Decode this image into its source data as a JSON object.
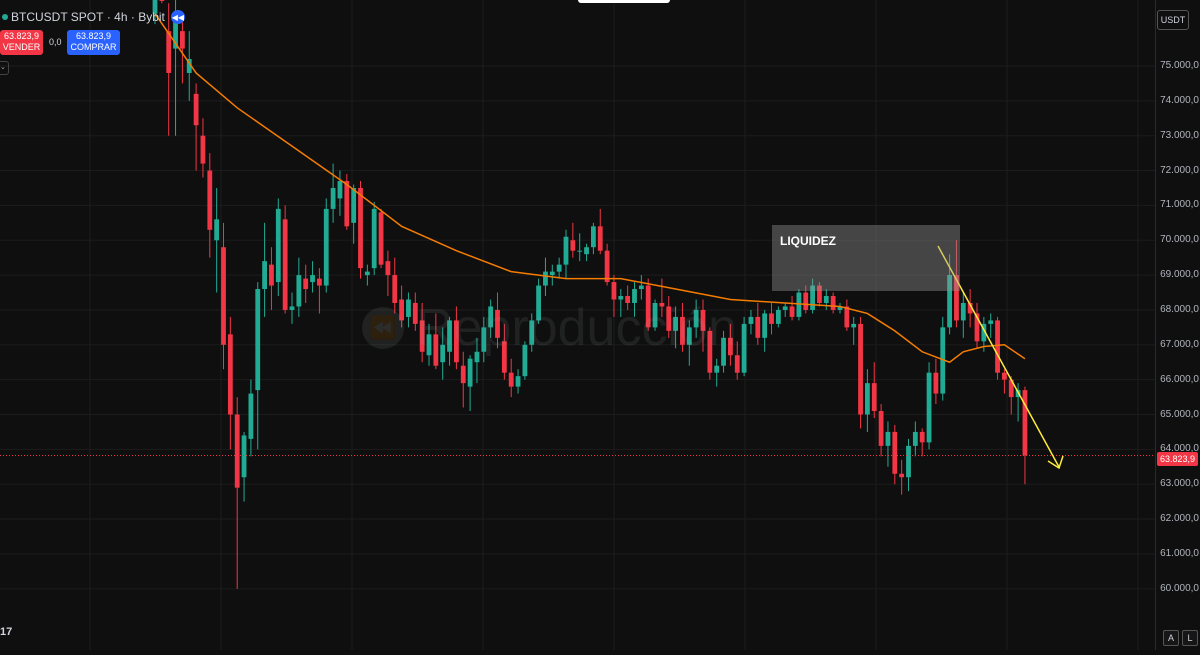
{
  "header": {
    "symbol": "BTCUSDT SPOT",
    "sep1": "·",
    "interval": "4h",
    "sep2": "·",
    "exchange": "Bybit",
    "replay_icon": "fast-backward-icon"
  },
  "trade": {
    "sell_price": "63.823,9",
    "sell_label": "VENDER",
    "spread": "0,0",
    "buy_price": "63.823,9",
    "buy_label": "COMPRAR"
  },
  "currency": "USDT",
  "last_price_label": "63.823,9",
  "watermark": "Reproducción",
  "logo_text": "17",
  "scale_buttons": {
    "auto": "A",
    "log": "L"
  },
  "price_axis": {
    "ticks": [
      "75.000,0",
      "74.000,0",
      "73.000,0",
      "72.000,0",
      "71.000,0",
      "70.000,0",
      "69.000,0",
      "68.000,0",
      "67.000,0",
      "66.000,0",
      "65.000,0",
      "64.000,0",
      "63.000,0",
      "62.000,0",
      "61.000,0",
      "60.000,0"
    ]
  },
  "colors": {
    "up": "#22ab94",
    "down": "#f23645",
    "ma": "#f57c00",
    "trend": "#ffeb3b",
    "background": "#0f0f0f"
  },
  "chart_data": {
    "type": "candlestick",
    "annotations": [
      {
        "type": "rectangle",
        "label": "LIQUIDEZ",
        "price_top": 70450,
        "price_bottom": 68550
      },
      {
        "type": "arrow",
        "color": "#ffeb3b",
        "direction": "down"
      }
    ],
    "last_price": 63823.9,
    "y_range": [
      59500,
      76500
    ],
    "candles": [
      [
        76500,
        78000,
        76200,
        77500
      ],
      [
        77500,
        78500,
        76800,
        77000
      ],
      [
        76000,
        76800,
        73000,
        74800
      ],
      [
        75500,
        77000,
        73000,
        76500
      ],
      [
        76000,
        76500,
        74500,
        75500
      ],
      [
        74800,
        76000,
        74000,
        75200
      ],
      [
        74200,
        74500,
        72000,
        73300
      ],
      [
        73000,
        73500,
        71800,
        72200
      ],
      [
        72000,
        72500,
        69500,
        70300
      ],
      [
        70000,
        71500,
        68500,
        70600
      ],
      [
        69800,
        70500,
        66300,
        67000
      ],
      [
        67300,
        67800,
        64000,
        65000
      ],
      [
        65000,
        65500,
        60000,
        62900
      ],
      [
        63200,
        64500,
        62500,
        64400
      ],
      [
        64300,
        66000,
        63800,
        65600
      ],
      [
        65700,
        68800,
        64000,
        68600
      ],
      [
        68600,
        70500,
        67800,
        69400
      ],
      [
        69300,
        69800,
        68000,
        68700
      ],
      [
        68800,
        71200,
        68400,
        70900
      ],
      [
        70600,
        71000,
        67900,
        68000
      ],
      [
        68000,
        68500,
        67600,
        68100
      ],
      [
        68100,
        69500,
        67800,
        69000
      ],
      [
        68900,
        69300,
        68200,
        68600
      ],
      [
        68800,
        69400,
        68500,
        69000
      ],
      [
        68900,
        69200,
        67900,
        68700
      ],
      [
        68700,
        71200,
        68500,
        70900
      ],
      [
        70900,
        72200,
        70500,
        71500
      ],
      [
        71200,
        72000,
        70700,
        71700
      ],
      [
        71700,
        71900,
        70300,
        70400
      ],
      [
        70500,
        71600,
        69900,
        71500
      ],
      [
        71500,
        71700,
        68900,
        69200
      ],
      [
        69000,
        69300,
        68700,
        69100
      ],
      [
        69200,
        71100,
        69000,
        70900
      ],
      [
        70800,
        70900,
        69200,
        69300
      ],
      [
        69400,
        69700,
        68400,
        69000
      ],
      [
        69000,
        69500,
        67900,
        68200
      ],
      [
        68300,
        68700,
        67500,
        67700
      ],
      [
        67800,
        68500,
        67500,
        68300
      ],
      [
        68200,
        68500,
        67400,
        67600
      ],
      [
        67700,
        68200,
        66500,
        66800
      ],
      [
        66700,
        67600,
        66400,
        67300
      ],
      [
        67300,
        67900,
        66300,
        66400
      ],
      [
        66500,
        67500,
        66000,
        67000
      ],
      [
        66800,
        67800,
        66400,
        67700
      ],
      [
        67700,
        68100,
        66300,
        66500
      ],
      [
        66400,
        66800,
        65200,
        65900
      ],
      [
        65800,
        66700,
        65100,
        66600
      ],
      [
        66500,
        67200,
        65900,
        66800
      ],
      [
        66800,
        67800,
        66500,
        67500
      ],
      [
        67500,
        68300,
        67200,
        68100
      ],
      [
        68000,
        68500,
        66900,
        67200
      ],
      [
        67100,
        67600,
        66000,
        66200
      ],
      [
        66200,
        66600,
        65500,
        65800
      ],
      [
        65800,
        66300,
        65600,
        66100
      ],
      [
        66100,
        67100,
        66000,
        67000
      ],
      [
        67000,
        67900,
        66800,
        67700
      ],
      [
        67700,
        68900,
        67600,
        68700
      ],
      [
        68700,
        69500,
        68400,
        69100
      ],
      [
        69000,
        69300,
        68700,
        69100
      ],
      [
        69100,
        69500,
        68900,
        69300
      ],
      [
        69300,
        70300,
        68900,
        70100
      ],
      [
        70000,
        70500,
        69500,
        69700
      ],
      [
        69700,
        70200,
        69400,
        69700
      ],
      [
        69600,
        69900,
        69400,
        69800
      ],
      [
        69800,
        70500,
        69600,
        70400
      ],
      [
        70400,
        70900,
        69600,
        69700
      ],
      [
        69700,
        69900,
        68700,
        68800
      ],
      [
        68800,
        69000,
        67800,
        68300
      ],
      [
        68300,
        68600,
        67800,
        68400
      ],
      [
        68400,
        68700,
        68000,
        68200
      ],
      [
        68200,
        68800,
        67800,
        68600
      ],
      [
        68600,
        69000,
        68300,
        68700
      ],
      [
        68700,
        68900,
        67400,
        67500
      ],
      [
        67500,
        68300,
        67400,
        68200
      ],
      [
        68200,
        68900,
        67800,
        68100
      ],
      [
        68100,
        68400,
        67200,
        67400
      ],
      [
        67400,
        68100,
        66900,
        67800
      ],
      [
        67800,
        68200,
        66800,
        67000
      ],
      [
        67000,
        67700,
        66400,
        67500
      ],
      [
        67500,
        68300,
        67200,
        68000
      ],
      [
        68000,
        68300,
        66800,
        67400
      ],
      [
        67400,
        67500,
        66000,
        66200
      ],
      [
        66200,
        66600,
        65800,
        66400
      ],
      [
        66400,
        67400,
        66200,
        67200
      ],
      [
        67200,
        67600,
        66400,
        66700
      ],
      [
        66700,
        67100,
        66000,
        66200
      ],
      [
        66200,
        67800,
        66100,
        67600
      ],
      [
        67600,
        68000,
        67300,
        67800
      ],
      [
        67800,
        68200,
        67000,
        67200
      ],
      [
        67200,
        68000,
        66800,
        67900
      ],
      [
        67900,
        68200,
        67300,
        67600
      ],
      [
        67600,
        68100,
        67500,
        68000
      ],
      [
        68000,
        68200,
        67800,
        68100
      ],
      [
        68100,
        68400,
        67700,
        67800
      ],
      [
        67800,
        68600,
        67700,
        68500
      ],
      [
        68500,
        68700,
        67900,
        68000
      ],
      [
        68000,
        68900,
        67900,
        68700
      ],
      [
        68700,
        68800,
        68100,
        68200
      ],
      [
        68200,
        68600,
        68000,
        68400
      ],
      [
        68400,
        68500,
        67900,
        68000
      ],
      [
        68000,
        68200,
        67900,
        68100
      ],
      [
        68100,
        68300,
        67400,
        67500
      ],
      [
        67500,
        67800,
        67000,
        67600
      ],
      [
        67600,
        67800,
        64600,
        65000
      ],
      [
        65000,
        66300,
        64500,
        65900
      ],
      [
        65900,
        66500,
        64900,
        65100
      ],
      [
        65100,
        65300,
        63800,
        64100
      ],
      [
        64100,
        64800,
        63500,
        64500
      ],
      [
        64500,
        64700,
        63000,
        63300
      ],
      [
        63300,
        63700,
        62700,
        63200
      ],
      [
        63200,
        64300,
        62800,
        64100
      ],
      [
        64100,
        64800,
        63800,
        64500
      ],
      [
        64500,
        64600,
        63800,
        64200
      ],
      [
        64200,
        66500,
        64000,
        66200
      ],
      [
        66200,
        66600,
        65300,
        65600
      ],
      [
        65600,
        67800,
        65400,
        67500
      ],
      [
        67500,
        69600,
        67300,
        69000
      ],
      [
        69000,
        70000,
        67500,
        67700
      ],
      [
        67700,
        68500,
        67200,
        68200
      ],
      [
        68200,
        68600,
        67500,
        67900
      ],
      [
        67900,
        68200,
        66900,
        67100
      ],
      [
        67100,
        67800,
        66800,
        67600
      ],
      [
        67600,
        67900,
        67200,
        67700
      ],
      [
        67700,
        67800,
        66000,
        66200
      ],
      [
        66200,
        66300,
        65600,
        66000
      ],
      [
        66000,
        66100,
        65000,
        65500
      ],
      [
        65500,
        65900,
        64800,
        65700
      ],
      [
        65700,
        65800,
        63000,
        63824
      ]
    ],
    "ma_line": [
      [
        0,
        76500
      ],
      [
        6,
        74800
      ],
      [
        12,
        73800
      ],
      [
        20,
        72700
      ],
      [
        28,
        71600
      ],
      [
        36,
        70400
      ],
      [
        44,
        69700
      ],
      [
        52,
        69100
      ],
      [
        60,
        68900
      ],
      [
        68,
        68900
      ],
      [
        76,
        68600
      ],
      [
        84,
        68300
      ],
      [
        92,
        68200
      ],
      [
        100,
        68100
      ],
      [
        104,
        67900
      ],
      [
        108,
        67400
      ],
      [
        112,
        66800
      ],
      [
        116,
        66500
      ],
      [
        118,
        66800
      ],
      [
        121,
        66950
      ],
      [
        124,
        67000
      ],
      [
        127,
        66600
      ]
    ]
  }
}
